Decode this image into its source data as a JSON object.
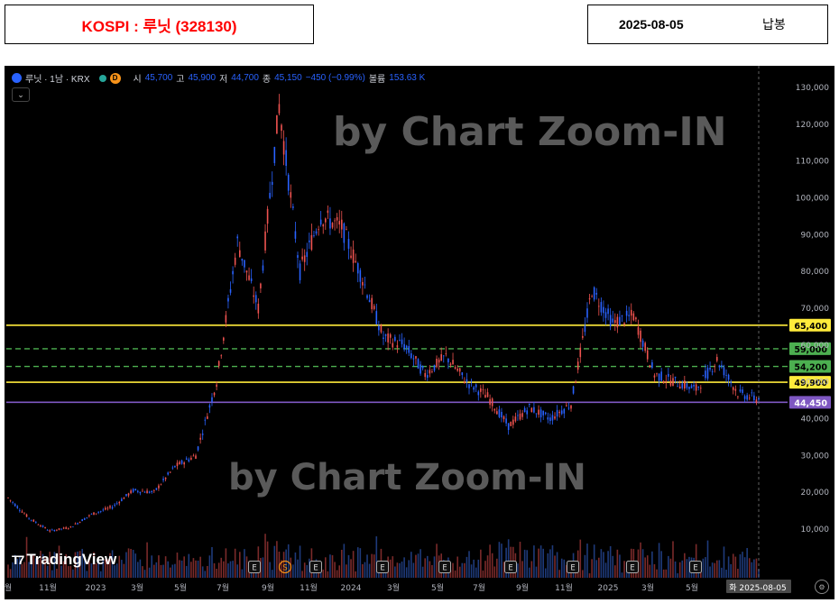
{
  "header": {
    "title": "KOSPI : 루닛 (328130)",
    "date": "2025-08-05",
    "kind": "납봉"
  },
  "legend": {
    "symbol": "루닛 · 1남 · KRX",
    "badge": "D",
    "open_label": "시",
    "open": "45,700",
    "high_label": "고",
    "high": "45,900",
    "low_label": "저",
    "low": "44,700",
    "close_label": "종",
    "close": "45,150",
    "change": "−450 (−0.99%)",
    "volume_label": "볼륨",
    "volume": "153.63 K"
  },
  "watermark": "by Chart Zoom-IN",
  "branding": "TradingView",
  "chart_data": {
    "type": "candlestick",
    "y_axis": {
      "min": 0,
      "max": 132000,
      "ticks": [
        10000,
        20000,
        30000,
        40000,
        50000,
        60000,
        70000,
        80000,
        90000,
        100000,
        110000,
        120000,
        130000
      ],
      "tick_labels": [
        "10,000",
        "20,000",
        "30,000",
        "40,000",
        "50,000",
        "60,000",
        "70,000",
        "80,000",
        "90,000",
        "100,000",
        "110,000",
        "120,000",
        "130,000"
      ]
    },
    "x_axis": {
      "labels": [
        "월",
        "11월",
        "2023",
        "3월",
        "5월",
        "7월",
        "9월",
        "11월",
        "2024",
        "3월",
        "5월",
        "7월",
        "9월",
        "11월",
        "2025",
        "3월",
        "5월",
        "화 2025-08-05"
      ]
    },
    "price_path": [
      [
        "2022-08",
        18500
      ],
      [
        "2022-09",
        13000
      ],
      [
        "2022-10",
        9500
      ],
      [
        "2022-11",
        10500
      ],
      [
        "2022-12",
        14000
      ],
      [
        "2023-01",
        16000
      ],
      [
        "2023-02",
        20500
      ],
      [
        "2023-03",
        20000
      ],
      [
        "2023-04",
        27000
      ],
      [
        "2023-05",
        30000
      ],
      [
        "2023-06",
        50000
      ],
      [
        "2023-07",
        88000
      ],
      [
        "2023-08",
        70000
      ],
      [
        "2023-09",
        125000
      ],
      [
        "2023-10",
        80000
      ],
      [
        "2023-11",
        95000
      ],
      [
        "2023-12",
        92000
      ],
      [
        "2024-01",
        78000
      ],
      [
        "2024-02",
        62000
      ],
      [
        "2024-03",
        60000
      ],
      [
        "2024-04",
        52000
      ],
      [
        "2024-05",
        57000
      ],
      [
        "2024-06",
        50000
      ],
      [
        "2024-07",
        46000
      ],
      [
        "2024-08",
        38000
      ],
      [
        "2024-09",
        43000
      ],
      [
        "2024-10",
        40000
      ],
      [
        "2024-11",
        44000
      ],
      [
        "2024-12",
        75000
      ],
      [
        "2025-01",
        66000
      ],
      [
        "2025-02",
        68000
      ],
      [
        "2025-03",
        52000
      ],
      [
        "2025-04",
        50000
      ],
      [
        "2025-05",
        48000
      ],
      [
        "2025-06",
        56000
      ],
      [
        "2025-07",
        47000
      ],
      [
        "2025-08",
        45150
      ]
    ],
    "levels": [
      {
        "value": 65400,
        "label": "65,400",
        "style": "solid",
        "color": "#ffeb3b"
      },
      {
        "value": 59000,
        "label": "59,000",
        "style": "dashed",
        "color": "#4caf50"
      },
      {
        "value": 54200,
        "label": "54,200",
        "style": "dashed",
        "color": "#4caf50"
      },
      {
        "value": 49900,
        "label": "49,900",
        "style": "solid",
        "color": "#ffeb3b"
      },
      {
        "value": 44450,
        "label": "44,450",
        "style": "solid",
        "color": "#7e57c2"
      }
    ],
    "event_markers": [
      "E",
      "S",
      "E",
      "E",
      "E",
      "E",
      "E",
      "E",
      "E"
    ],
    "colors": {
      "up": "#ef5350",
      "down": "#2962ff",
      "background": "#000000"
    }
  }
}
